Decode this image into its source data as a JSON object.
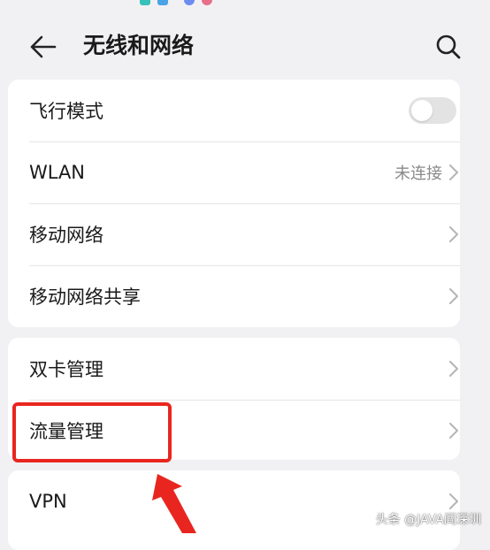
{
  "header": {
    "title": "无线和网络",
    "back_icon": "arrow-left-icon",
    "search_icon": "search-icon"
  },
  "sections": [
    {
      "items": [
        {
          "label": "飞行模式",
          "control": "toggle",
          "checked": false
        },
        {
          "label": "WLAN",
          "value": "未连接",
          "control": "chevron"
        },
        {
          "label": "移动网络",
          "control": "chevron"
        },
        {
          "label": "移动网络共享",
          "control": "chevron"
        }
      ]
    },
    {
      "items": [
        {
          "label": "双卡管理",
          "control": "chevron"
        },
        {
          "label": "流量管理",
          "control": "chevron",
          "highlighted": true
        }
      ]
    },
    {
      "items": [
        {
          "label": "VPN",
          "control": "chevron"
        }
      ]
    }
  ],
  "watermark": "头条 @JAVA阎深圳",
  "colors": {
    "background": "#f1f1f3",
    "card": "#ffffff",
    "highlight": "#e8261f",
    "secondary_text": "#8a8a8a",
    "chevron": "#b5b5b5"
  }
}
